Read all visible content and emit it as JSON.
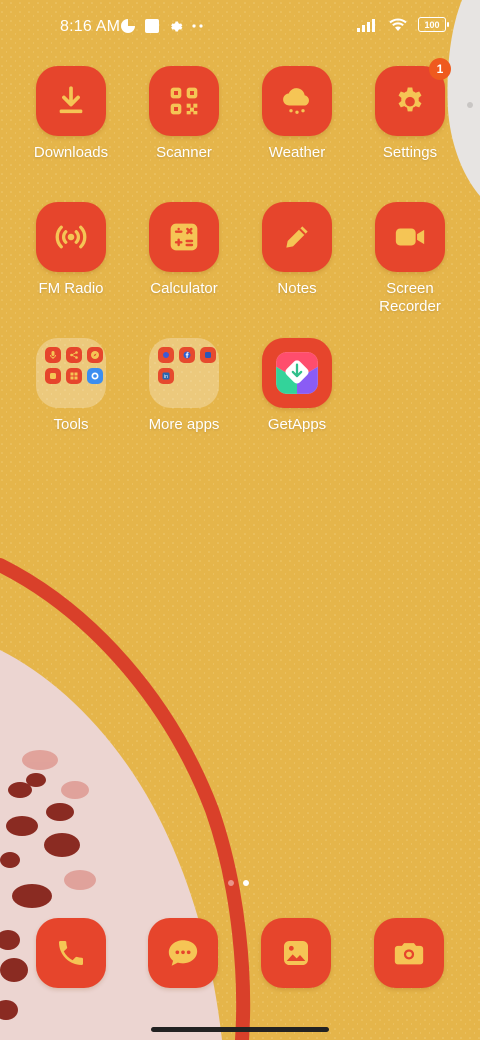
{
  "status_bar": {
    "time": "8:16 AM",
    "battery": "100",
    "icons_left": [
      "data-saver-icon",
      "notification-square-icon",
      "settings-gear-icon",
      "more-dots-icon"
    ],
    "icons_right": [
      "signal-icon",
      "wifi-icon",
      "battery-icon"
    ]
  },
  "apps": [
    {
      "label": "Downloads",
      "icon": "download-icon"
    },
    {
      "label": "Scanner",
      "icon": "qr-scanner-icon"
    },
    {
      "label": "Weather",
      "icon": "weather-cloud-icon"
    },
    {
      "label": "Settings",
      "icon": "gear-icon",
      "badge": "1"
    },
    {
      "label": "FM Radio",
      "icon": "radio-icon"
    },
    {
      "label": "Calculator",
      "icon": "calculator-icon"
    },
    {
      "label": "Notes",
      "icon": "pencil-icon"
    },
    {
      "label": "Screen\nRecorder",
      "icon": "video-camera-icon"
    },
    {
      "label": "Tools",
      "icon": "folder-icon"
    },
    {
      "label": "More apps",
      "icon": "folder-icon"
    },
    {
      "label": "GetApps",
      "icon": "getapps-icon"
    }
  ],
  "dock": [
    {
      "name": "phone",
      "icon": "phone-icon"
    },
    {
      "name": "messages",
      "icon": "message-bubble-icon"
    },
    {
      "name": "gallery",
      "icon": "gallery-image-icon"
    },
    {
      "name": "camera",
      "icon": "camera-icon"
    }
  ],
  "page_indicator": {
    "pages": 2,
    "active": 2
  },
  "colors": {
    "background": "#e5b54a",
    "icon_bg": "#e6452c",
    "icon_glyph": "#f5c555",
    "wallpaper_red": "#d9402a",
    "wallpaper_pink": "#ecd5d1",
    "badge": "#ef5a1e"
  }
}
